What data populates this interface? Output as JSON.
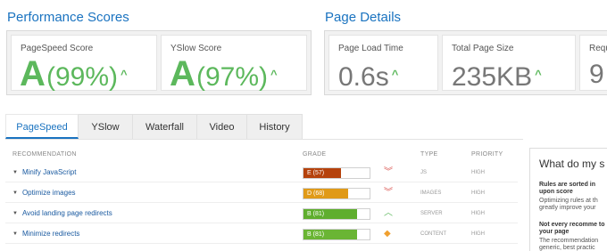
{
  "performance": {
    "title": "Performance Scores",
    "pagespeed": {
      "label": "PageSpeed Score",
      "grade": "A",
      "percent": "(99%)"
    },
    "yslow": {
      "label": "YSlow Score",
      "grade": "A",
      "percent": "(97%)"
    }
  },
  "details": {
    "title": "Page Details",
    "load_time": {
      "label": "Page Load Time",
      "value": "0.6s"
    },
    "page_size": {
      "label": "Total Page Size",
      "value": "235KB"
    },
    "requests": {
      "label": "Requ",
      "value": "9"
    }
  },
  "tabs": [
    {
      "label": "PageSpeed"
    },
    {
      "label": "YSlow"
    },
    {
      "label": "Waterfall"
    },
    {
      "label": "Video"
    },
    {
      "label": "History"
    }
  ],
  "table": {
    "headers": {
      "recommendation": "RECOMMENDATION",
      "grade": "GRADE",
      "type": "TYPE",
      "priority": "PRIORITY"
    },
    "rows": [
      {
        "name": "Minify JavaScript",
        "grade": "E (57)",
        "score": 57,
        "color": "#b5420c",
        "impact": "down-chevron",
        "impact_color": "#d9534f",
        "type": "JS",
        "priority": "HIGH"
      },
      {
        "name": "Optimize images",
        "grade": "D (68)",
        "score": 68,
        "color": "#e09a18",
        "impact": "down-chevron",
        "impact_color": "#d9534f",
        "type": "IMAGES",
        "priority": "HIGH"
      },
      {
        "name": "Avoid landing page redirects",
        "grade": "B (81)",
        "score": 81,
        "color": "#5fae2e",
        "impact": "up-chevron",
        "impact_color": "#5cb85c",
        "type": "SERVER",
        "priority": "HIGH"
      },
      {
        "name": "Minimize redirects",
        "grade": "B (81)",
        "score": 81,
        "color": "#6ab534",
        "impact": "diamond",
        "impact_color": "#f0a030",
        "type": "CONTENT",
        "priority": "HIGH"
      }
    ]
  },
  "sidebar": {
    "title": "What do my s",
    "block1_head": "Rules are sorted in upon score",
    "block1_text": "Optimizing rules at th greatly improve your",
    "block2_head": "Not every recomme to your page",
    "block2_text": "The recommendation generic, best practic"
  },
  "colors": {
    "accent": "#1a73c0",
    "good": "#5cb85c"
  }
}
